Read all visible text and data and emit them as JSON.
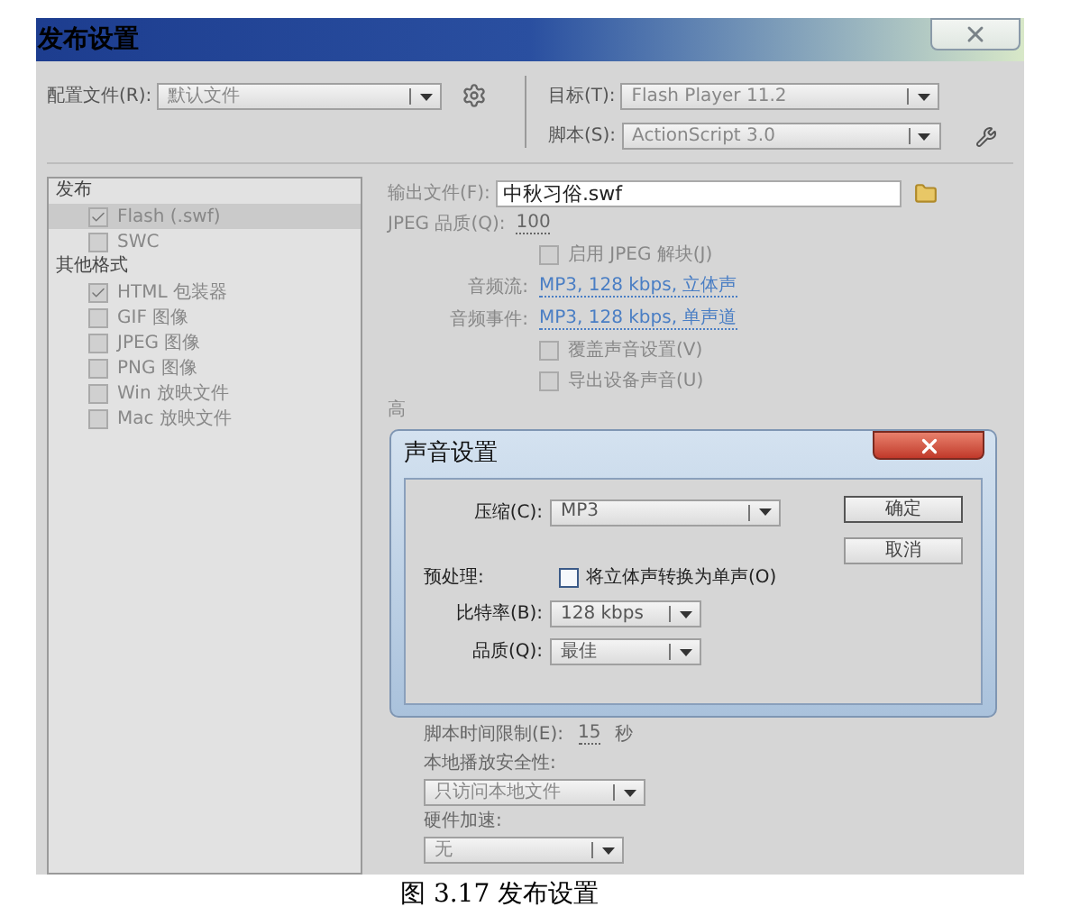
{
  "window": {
    "title": "发布设置"
  },
  "profile": {
    "label": "配置文件(R):",
    "value": "默认文件"
  },
  "target": {
    "label": "目标(T):",
    "value": "Flash Player 11.2"
  },
  "script": {
    "label": "脚本(S):",
    "value": "ActionScript 3.0"
  },
  "formats": [
    {
      "heading": "发布",
      "children": [
        {
          "label": "Flash (.swf)",
          "checked": true,
          "selected": true
        },
        {
          "label": "SWC",
          "checked": false,
          "selected": false
        }
      ]
    },
    {
      "heading": "其他格式",
      "children": [
        {
          "label": "HTML 包装器",
          "checked": true,
          "selected": false
        },
        {
          "label": "GIF 图像",
          "checked": false,
          "selected": false
        },
        {
          "label": "JPEG 图像",
          "checked": false,
          "selected": false
        },
        {
          "label": "PNG 图像",
          "checked": false,
          "selected": false
        },
        {
          "label": "Win 放映文件",
          "checked": false,
          "selected": false
        },
        {
          "label": "Mac 放映文件",
          "checked": false,
          "selected": false
        }
      ]
    }
  ],
  "output_file": {
    "label": "输出文件(F):",
    "value": "中秋习俗.swf"
  },
  "jpeg_quality": {
    "label": "JPEG 品质(Q):",
    "value": "100"
  },
  "jpeg_deblocking": {
    "label": "启用 JPEG 解块(J)",
    "checked": false
  },
  "audio_stream": {
    "label": "音频流:",
    "value": "MP3, 128 kbps, 立体声"
  },
  "audio_event": {
    "label": "音频事件:",
    "value": "MP3, 128 kbps, 单声道"
  },
  "override_sound": {
    "label": "覆盖声音设置(V)",
    "checked": false
  },
  "export_device_sound": {
    "label": "导出设备声音(U)",
    "checked": false
  },
  "advanced_heading": "高",
  "script_time_limit": {
    "label": "脚本时间限制(E):",
    "value": "15",
    "unit": "秒"
  },
  "local_playback_security": {
    "label": "本地播放安全性:",
    "value": "只访问本地文件"
  },
  "hardware_acceleration": {
    "label": "硬件加速:",
    "value": "无"
  },
  "sound_dialog": {
    "title": "声音设置",
    "compression": {
      "label": "压缩(C):",
      "value": "MP3"
    },
    "preprocess": {
      "label": "预处理:",
      "option": "将立体声转换为单声(O)",
      "checked": false
    },
    "bit_rate": {
      "label": "比特率(B):",
      "value": "128 kbps"
    },
    "quality": {
      "label": "品质(Q):",
      "value": "最佳"
    },
    "buttons": [
      "确定",
      "取消"
    ]
  },
  "caption": "图 3.17 发布设置"
}
